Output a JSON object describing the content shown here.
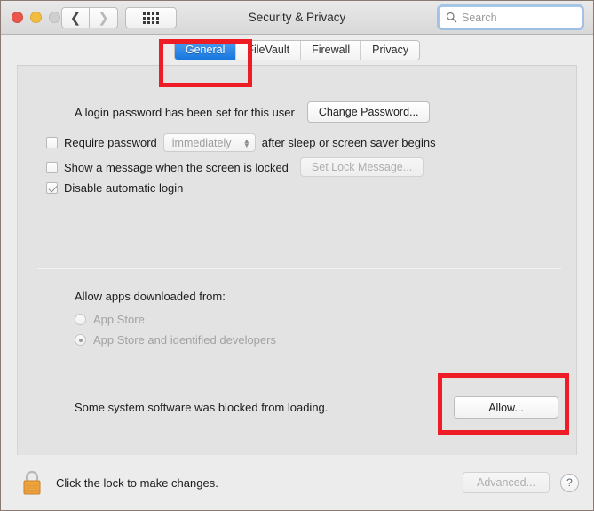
{
  "window": {
    "title": "Security & Privacy",
    "traffic_lights": [
      "close",
      "minimize",
      "zoom"
    ],
    "nav": {
      "back_icon": "chevron-left-icon",
      "forward_icon": "chevron-right-icon"
    },
    "grid_button_icon": "show-all-grid-icon"
  },
  "search": {
    "placeholder": "Search",
    "value": "",
    "icon": "search-icon"
  },
  "tabs": [
    {
      "label": "General",
      "active": true
    },
    {
      "label": "FileVault",
      "active": false
    },
    {
      "label": "Firewall",
      "active": false
    },
    {
      "label": "Privacy",
      "active": false
    }
  ],
  "general": {
    "password_status": "A login password has been set for this user",
    "change_password_label": "Change Password...",
    "require_password": {
      "checked": false,
      "label_before": "Require password",
      "delay_value": "immediately",
      "label_after": "after sleep or screen saver begins"
    },
    "lock_message": {
      "checked": false,
      "label": "Show a message when the screen is locked",
      "button_label": "Set Lock Message..."
    },
    "disable_auto_login": {
      "checked": true,
      "label": "Disable automatic login"
    },
    "allow_apps": {
      "title": "Allow apps downloaded from:",
      "options": [
        {
          "label": "App Store",
          "selected": false
        },
        {
          "label": "App Store and identified developers",
          "selected": true
        }
      ]
    },
    "blocked_software": {
      "message": "Some system software was blocked from loading.",
      "allow_label": "Allow..."
    }
  },
  "bottom": {
    "lock_icon": "locked-padlock-icon",
    "lock_text": "Click the lock to make changes.",
    "advanced_label": "Advanced...",
    "help_label": "?"
  },
  "annotations": {
    "highlight_color": "#ee1c25",
    "targets": [
      "general-tab",
      "allow-button"
    ]
  }
}
